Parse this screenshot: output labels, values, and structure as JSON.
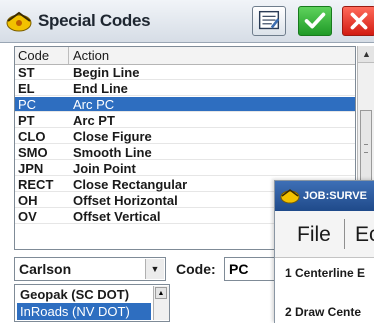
{
  "window": {
    "title": "Special Codes",
    "colors": {
      "titlebar": "#d6dde6",
      "ok": "#2bb034",
      "close": "#e0241a",
      "selection": "#2e6ec0"
    }
  },
  "toolbar": {
    "notes_icon": "notepad-icon",
    "ok_icon": "checkmark-icon",
    "close_icon": "close-icon"
  },
  "list": {
    "columns": [
      "Code",
      "Action"
    ],
    "rows": [
      {
        "code": "ST",
        "action": "Begin Line"
      },
      {
        "code": "EL",
        "action": "End Line"
      },
      {
        "code": "PC",
        "action": "Arc PC"
      },
      {
        "code": "PT",
        "action": "Arc PT"
      },
      {
        "code": "CLO",
        "action": "Close Figure"
      },
      {
        "code": "SMO",
        "action": "Smooth Line"
      },
      {
        "code": "JPN",
        "action": "Join Point"
      },
      {
        "code": "RECT",
        "action": "Close Rectangular"
      },
      {
        "code": "OH",
        "action": "Offset Horizontal"
      },
      {
        "code": "OV",
        "action": "Offset Vertical"
      }
    ],
    "selected_index": 2
  },
  "form": {
    "style_value": "Carlson",
    "code_label": "Code:",
    "code_value": "PC"
  },
  "style_dropdown": {
    "items": [
      "Geopak (SC DOT)",
      "InRoads (NV DOT)"
    ],
    "selected_index": 1
  },
  "background_window": {
    "title": "JOB:SURVE",
    "menu": [
      "File",
      "Ec"
    ],
    "items": [
      "1 Centerline E",
      "2 Draw Cente"
    ]
  }
}
